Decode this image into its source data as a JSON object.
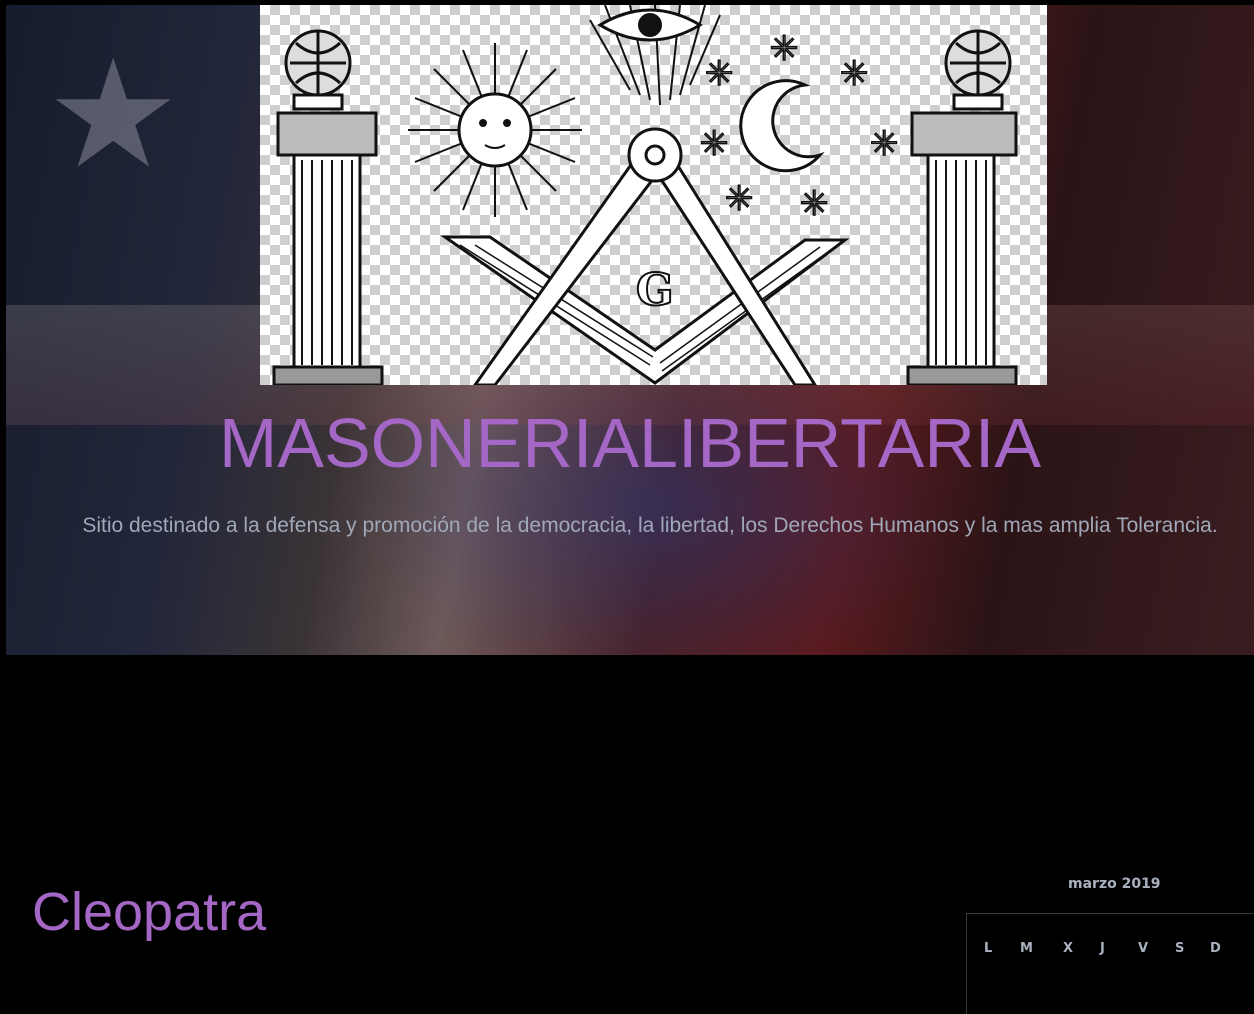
{
  "header": {
    "title": "MASONERIALIBERTARIA",
    "description": "Sitio destinado a la defensa y promoción de la democracia, la libertad, los Derechos Humanos y la mas amplia Tolerancia.",
    "image_text": "G"
  },
  "post": {
    "title": "Cleopatra"
  },
  "calendar": {
    "caption": "marzo 2019",
    "days": [
      "L",
      "M",
      "X",
      "J",
      "V",
      "S",
      "D"
    ]
  }
}
